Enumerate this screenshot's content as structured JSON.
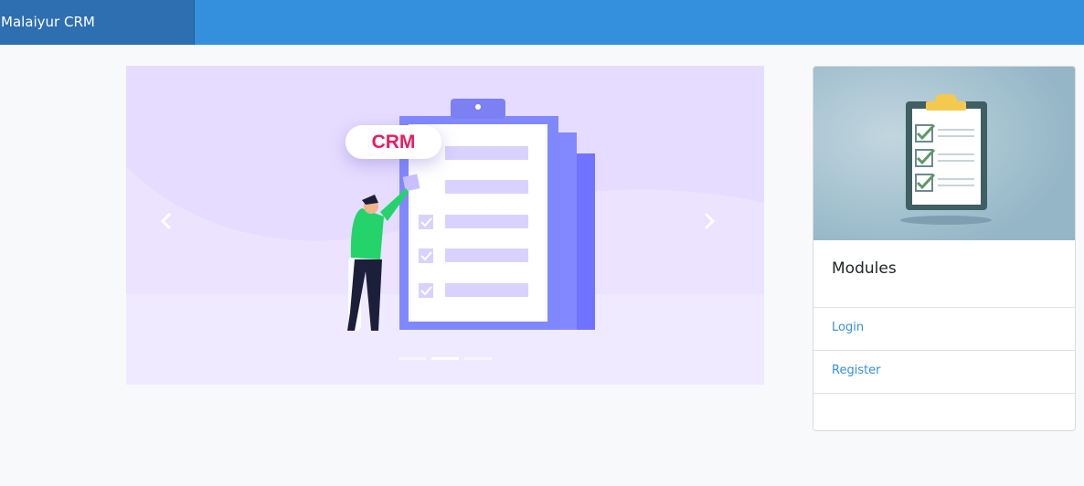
{
  "navbar": {
    "brand": "Malaiyur CRM"
  },
  "carousel": {
    "badge_text": "CRM",
    "prev_icon": "chevron-left-icon",
    "next_icon": "chevron-right-icon",
    "slide_count": 3,
    "active_slide": 2
  },
  "card": {
    "image_icon": "clipboard-checklist-icon",
    "title": "Modules",
    "links": [
      {
        "label": "Login"
      },
      {
        "label": "Register"
      }
    ]
  },
  "colors": {
    "navbar": "#3490dc",
    "brand_bg": "#2d6fb0",
    "link": "#3490dc",
    "carousel_bg": "#e6dcff",
    "badge_text": "#e81e63"
  }
}
